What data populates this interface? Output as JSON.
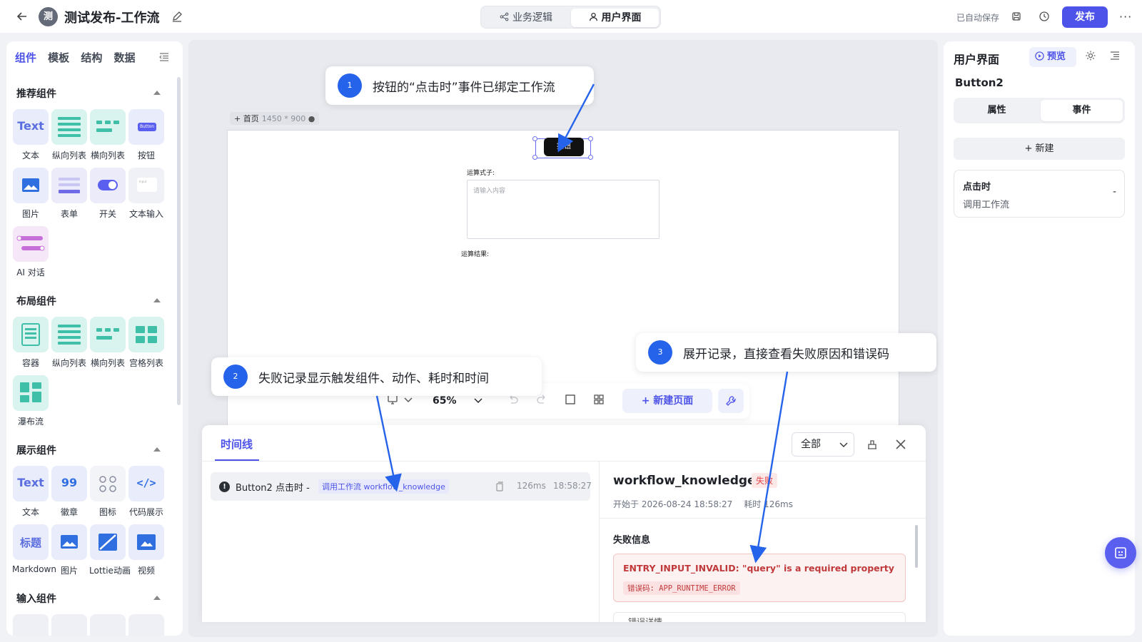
{
  "header": {
    "app_avatar": "测",
    "app_title": "测试发布-工作流",
    "view_tabs": [
      {
        "label": "业务逻辑",
        "icon": "share-node-icon"
      },
      {
        "label": "用户界面",
        "icon": "user-icon"
      }
    ],
    "autosave": "已自动保存",
    "publish": "发布",
    "more": "···"
  },
  "left_panel": {
    "tabs": [
      "组件",
      "模板",
      "结构",
      "数据"
    ],
    "sections": [
      {
        "title": "推荐组件",
        "items": [
          "文本",
          "纵向列表",
          "横向列表",
          "按钮",
          "图片",
          "表单",
          "开关",
          "文本输入",
          "AI 对话"
        ]
      },
      {
        "title": "布局组件",
        "items": [
          "容器",
          "纵向列表",
          "横向列表",
          "宫格列表",
          "瀑布流"
        ]
      },
      {
        "title": "展示组件",
        "items": [
          "文本",
          "徽章",
          "图标",
          "代码展示",
          "Markdown",
          "图片",
          "Lottie动画",
          "视频"
        ]
      },
      {
        "title": "输入组件",
        "items": []
      }
    ],
    "tile_text": {
      "text": "Text",
      "button": "Button",
      "input": "Input",
      "badge": "99",
      "code": "</>",
      "heading": "标题"
    }
  },
  "canvas": {
    "page_name": "首页",
    "page_dims": "1450 * 900",
    "button_label": "按钮",
    "formula_label": "运算式子:",
    "input_placeholder": "请输入内容",
    "result_label": "运算结果:",
    "zoom": "65%",
    "new_page": "新建页面"
  },
  "timeline": {
    "tab": "时间线",
    "filter": "全部",
    "record": {
      "name": "Button2 点击时 -",
      "tag": "调用工作流 workflow_knowledge",
      "duration": "126ms",
      "time": "18:58:27",
      "status_icon": "!"
    },
    "detail": {
      "title": "workflow_knowledge",
      "status": "失败",
      "started": "开始于 2026-08-24 18:58:27",
      "elapsed": "耗时 126ms",
      "section": "失败信息",
      "error_message": "ENTRY_INPUT_INVALID: \"query\" is a required property",
      "error_code": "错误码: APP_RUNTIME_ERROR",
      "error_detail": "错误详情"
    }
  },
  "right_panel": {
    "title": "用户界面",
    "preview": "预览",
    "component": "Button2",
    "seg_tabs": [
      "属性",
      "事件"
    ],
    "new_button": "+ 新建",
    "event": {
      "title": "点击时",
      "desc": "调用工作流",
      "remove": "-"
    }
  },
  "callouts": [
    {
      "num": "1",
      "text": "按钮的“点击时”事件已绑定工作流"
    },
    {
      "num": "2",
      "text": "失败记录显示触发组件、动作、耗时和时间"
    },
    {
      "num": "3",
      "text": "展开记录，直接查看失败原因和错误码"
    }
  ],
  "colors": {
    "accent": "#4d53e8",
    "callout": "#2563eb",
    "error": "#c0393b",
    "teal_tile": "#d9f3ef"
  }
}
